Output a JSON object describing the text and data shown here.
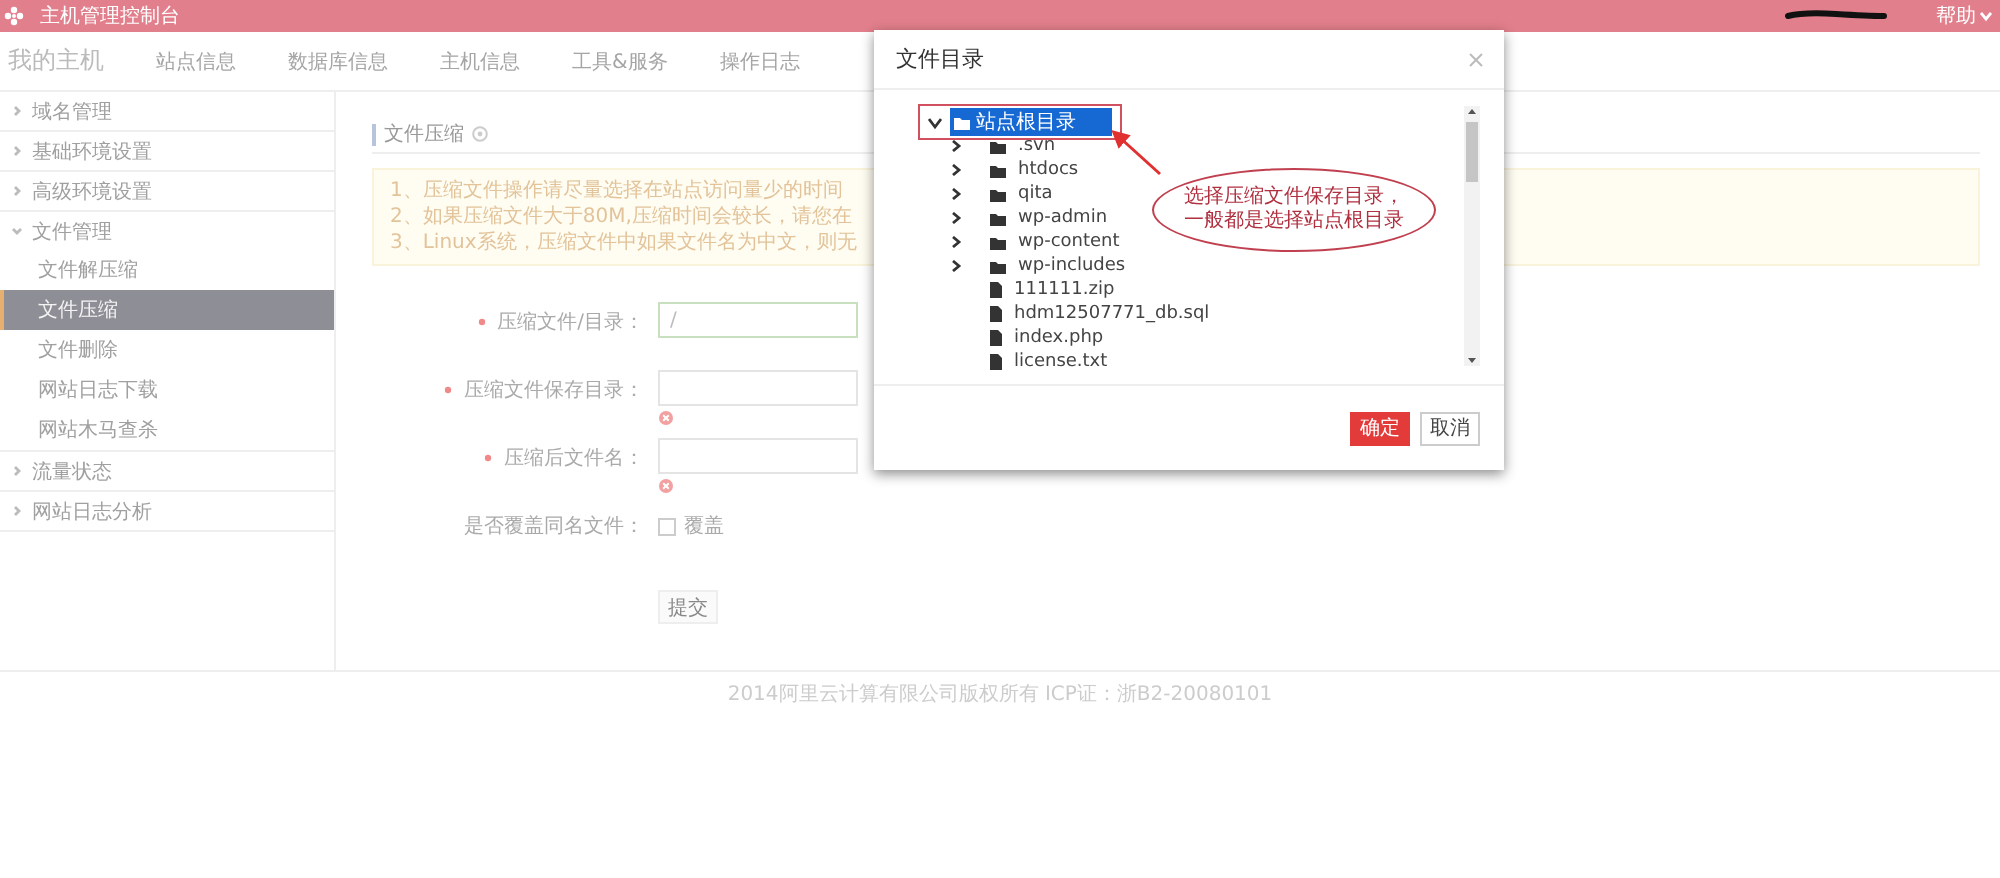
{
  "topbar": {
    "title": "主机管理控制台",
    "help": "帮助"
  },
  "nav": {
    "brand": "我的主机",
    "items": [
      "站点信息",
      "数据库信息",
      "主机信息",
      "工具&服务",
      "操作日志"
    ]
  },
  "sidebar": {
    "items": [
      {
        "label": "域名管理",
        "expanded": false
      },
      {
        "label": "基础环境设置",
        "expanded": false
      },
      {
        "label": "高级环境设置",
        "expanded": false
      },
      {
        "label": "文件管理",
        "expanded": true,
        "children": [
          {
            "label": "文件解压缩",
            "selected": false
          },
          {
            "label": "文件压缩",
            "selected": true
          },
          {
            "label": "文件删除",
            "selected": false
          },
          {
            "label": "网站日志下载",
            "selected": false
          },
          {
            "label": "网站木马查杀",
            "selected": false
          }
        ]
      },
      {
        "label": "流量状态",
        "expanded": false
      },
      {
        "label": "网站日志分析",
        "expanded": false
      }
    ]
  },
  "content": {
    "title": "文件压缩",
    "notice": [
      "1、压缩文件操作请尽量选择在站点访问量少的时间",
      "2、如果压缩文件大于80M,压缩时间会较长，请您在",
      "3、Linux系统，压缩文件中如果文件名为中文，则无"
    ],
    "form": [
      {
        "kind": "input",
        "label": "压缩文件/目录：",
        "required": true,
        "value": "/",
        "error": false
      },
      {
        "kind": "input",
        "label": "压缩文件保存目录：",
        "required": true,
        "error": true
      },
      {
        "kind": "input",
        "label": "压缩后文件名：",
        "required": true,
        "error": true
      },
      {
        "kind": "checkbox",
        "label": "是否覆盖同名文件：",
        "required": false,
        "checked": false,
        "option": "覆盖"
      }
    ],
    "submit": "提交"
  },
  "footer": "2014阿里云计算有限公司版权所有 ICP证：浙B2-20080101",
  "dialog": {
    "title": "文件目录",
    "tree": {
      "label": "站点根目录",
      "kind": "folder",
      "expanded": true,
      "selected": true,
      "children": [
        {
          "label": ".svn",
          "kind": "folder",
          "expanded": false
        },
        {
          "label": "htdocs",
          "kind": "folder",
          "expanded": false
        },
        {
          "label": "qita",
          "kind": "folder",
          "expanded": false
        },
        {
          "label": "wp-admin",
          "kind": "folder",
          "expanded": false
        },
        {
          "label": "wp-content",
          "kind": "folder",
          "expanded": false
        },
        {
          "label": "wp-includes",
          "kind": "folder",
          "expanded": false
        },
        {
          "label": "111111.zip",
          "kind": "file"
        },
        {
          "label": "hdm12507771_db.sql",
          "kind": "file"
        },
        {
          "label": "index.php",
          "kind": "file"
        },
        {
          "label": "license.txt",
          "kind": "file"
        }
      ]
    },
    "callout": [
      "选择压缩文件保存目录，",
      "一般都是选择站点根目录"
    ],
    "buttons": [
      {
        "label": "确定",
        "kind": "primary"
      },
      {
        "label": "取消",
        "kind": "default"
      }
    ]
  }
}
